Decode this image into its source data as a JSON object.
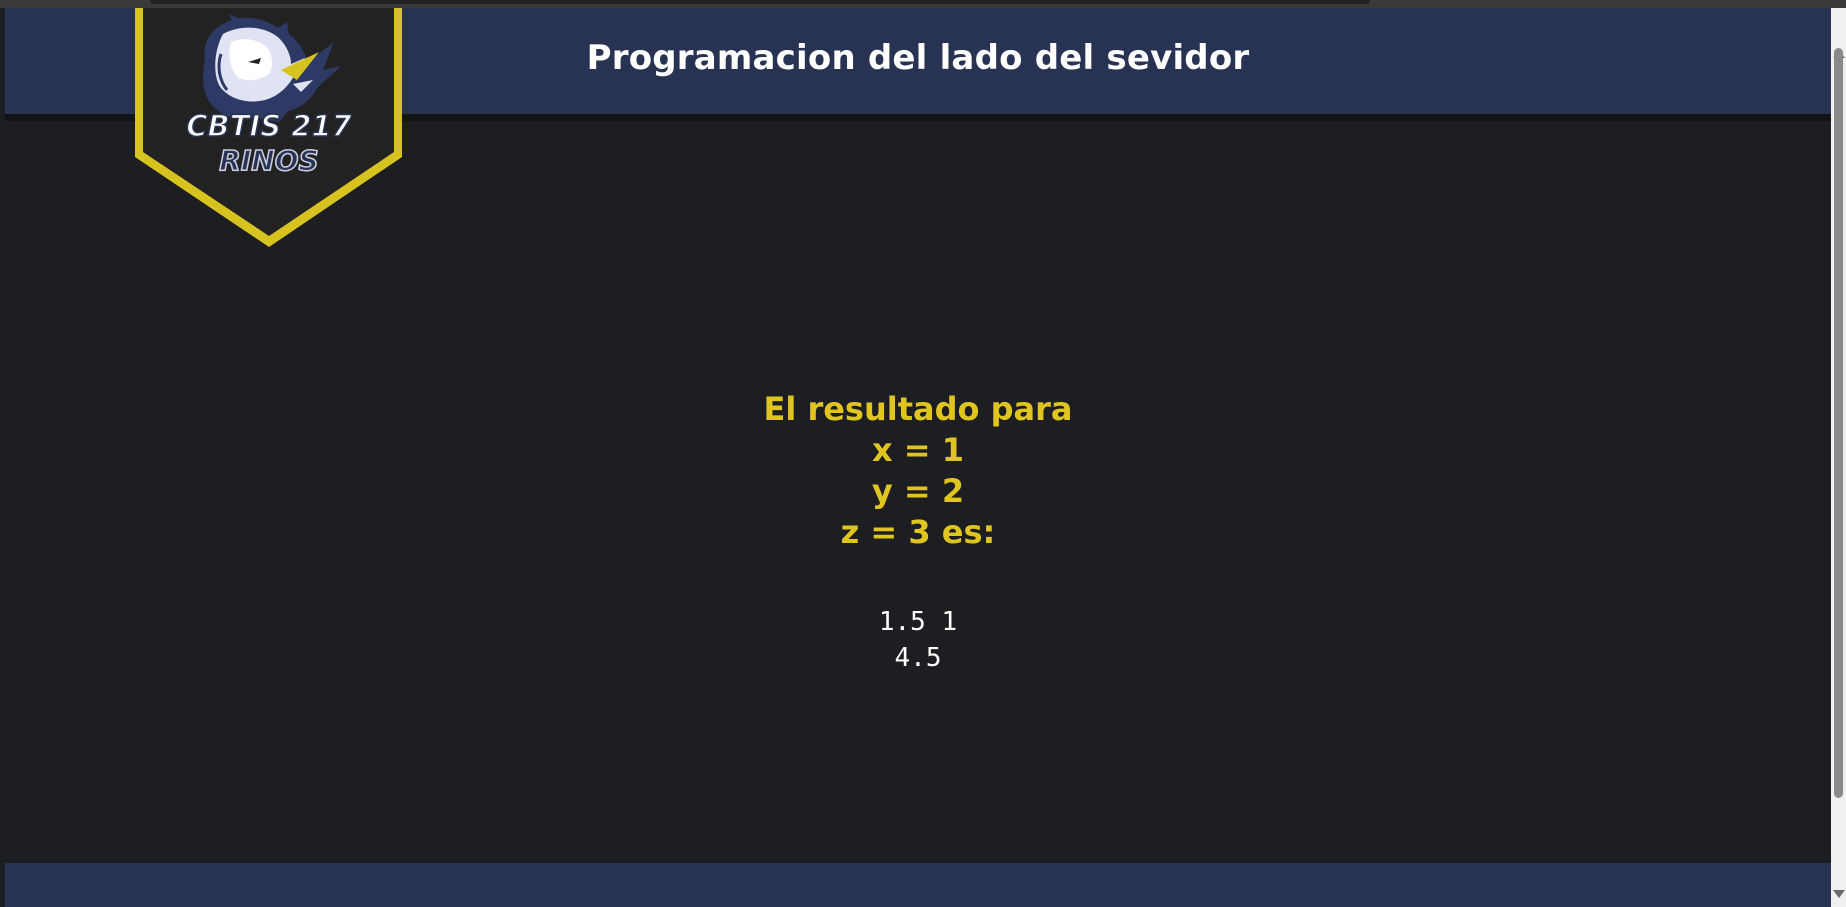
{
  "header": {
    "title": "Programacion del lado del sevidor"
  },
  "logo": {
    "icon": "rhino-mascot-icon",
    "line1": "CBTIS 217",
    "line2": "RINOS",
    "colors": {
      "badge_fill": "#232222",
      "badge_border": "#d6c31f",
      "text_fill": "#ffffff",
      "text_outline": "#283252"
    }
  },
  "result": {
    "lines": [
      "El resultado para",
      "x = 1",
      "y = 2",
      "z = 3 es:"
    ]
  },
  "output": {
    "lines": [
      "1.5 1",
      "4.5"
    ]
  },
  "colors": {
    "header_bg": "#283252",
    "content_bg": "#1d1e22",
    "accent_yellow": "#e0c520",
    "text_white": "#ffffff"
  }
}
